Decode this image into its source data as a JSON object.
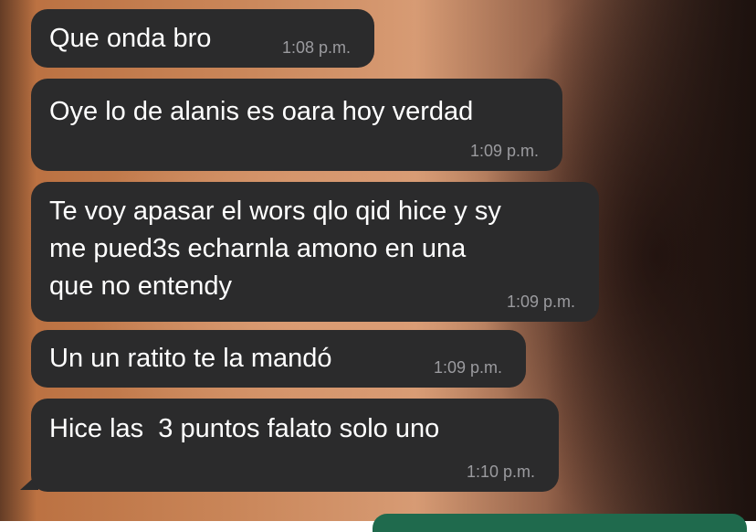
{
  "messages": [
    {
      "text": "Que onda bro",
      "time": "1:08 p.m."
    },
    {
      "text": "Oye lo de alanis es oara hoy verdad",
      "time": "1:09 p.m."
    },
    {
      "text": "Te voy apasar el wors qlo qid hice y sy\nme pued3s echarnla amono en una\nque no entendy",
      "time": "1:09 p.m."
    },
    {
      "text": "Un un ratito te la mandó",
      "time": "1:09 p.m."
    },
    {
      "text": "Hice las  3 puntos falato solo uno",
      "time": "1:10 p.m."
    }
  ],
  "colors": {
    "incoming_bubble": "#2b2b2c",
    "timestamp": "#9b9b9f",
    "outgoing_bubble": "#1f6a4d"
  }
}
